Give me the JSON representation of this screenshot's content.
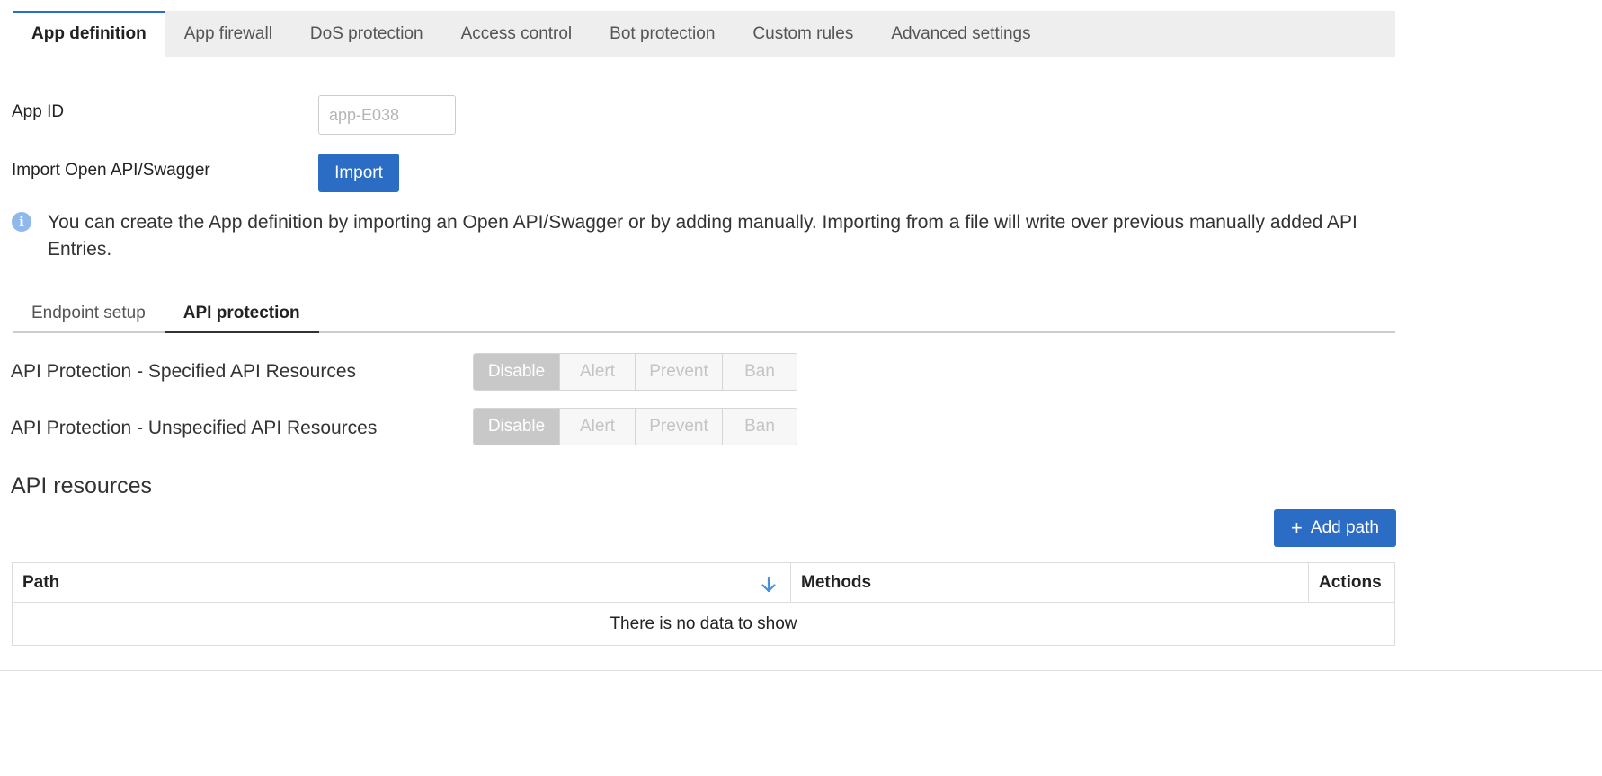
{
  "top_tabs": [
    {
      "label": "App definition",
      "active": true
    },
    {
      "label": "App firewall",
      "active": false
    },
    {
      "label": "DoS protection",
      "active": false
    },
    {
      "label": "Access control",
      "active": false
    },
    {
      "label": "Bot protection",
      "active": false
    },
    {
      "label": "Custom rules",
      "active": false
    },
    {
      "label": "Advanced settings",
      "active": false
    }
  ],
  "form": {
    "app_id_label": "App ID",
    "app_id_placeholder": "app-E038",
    "app_id_value": "",
    "import_label": "Import Open API/Swagger",
    "import_button": "Import"
  },
  "info": {
    "icon": "info-icon",
    "text": "You can create the App definition by importing an Open API/Swagger or by adding manually. Importing from a file will write over previous manually added API Entries."
  },
  "sub_tabs": [
    {
      "label": "Endpoint setup",
      "active": false
    },
    {
      "label": "API protection",
      "active": true
    }
  ],
  "protection": {
    "specified_label": "API Protection - Specified API Resources",
    "unspecified_label": "API Protection - Unspecified API Resources",
    "options": [
      "Disable",
      "Alert",
      "Prevent",
      "Ban"
    ],
    "specified_selected": "Disable",
    "unspecified_selected": "Disable"
  },
  "api_resources": {
    "title": "API resources",
    "add_button": "Add path",
    "add_icon": "plus-icon",
    "columns": [
      "Path",
      "Methods",
      "Actions"
    ],
    "sort_icon": "arrow-down-icon",
    "empty_text": "There is no data to show"
  },
  "colors": {
    "accent": "#2b6cc4",
    "info_icon": "#8fb8ec",
    "sort_icon": "#4a90d9",
    "segment_selected": "#c8c8c8"
  }
}
